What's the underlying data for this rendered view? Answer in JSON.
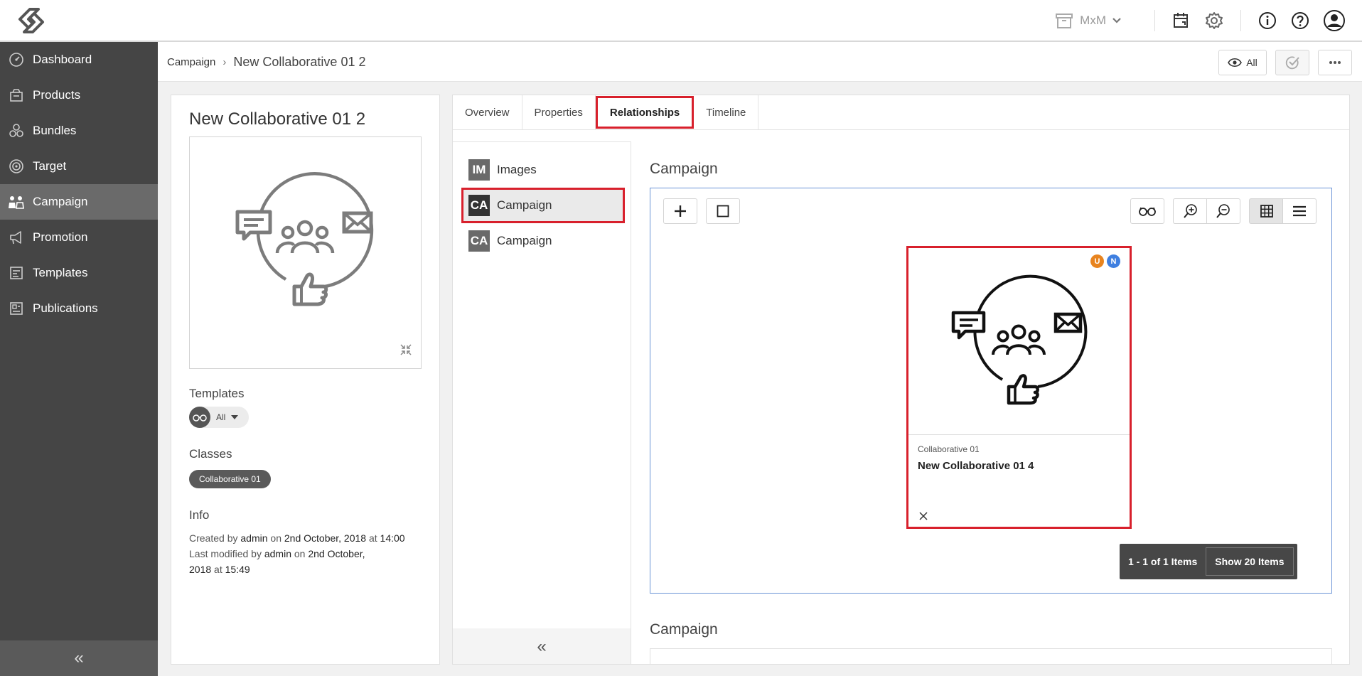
{
  "topbar": {
    "workspace_label": "MxM"
  },
  "sidebar": {
    "items": [
      {
        "label": "Dashboard",
        "icon": "gauge-icon"
      },
      {
        "label": "Products",
        "icon": "box-icon"
      },
      {
        "label": "Bundles",
        "icon": "bundles-icon"
      },
      {
        "label": "Target",
        "icon": "target-icon"
      },
      {
        "label": "Campaign",
        "icon": "campaign-icon",
        "active": true
      },
      {
        "label": "Promotion",
        "icon": "megaphone-icon"
      },
      {
        "label": "Templates",
        "icon": "template-icon"
      },
      {
        "label": "Publications",
        "icon": "publication-icon"
      }
    ],
    "collapse_glyph": "«"
  },
  "header": {
    "breadcrumb_root": "Campaign",
    "breadcrumb_sep": "›",
    "breadcrumb_current": "New Collaborative 01 2",
    "view_filter_label": "All"
  },
  "detail": {
    "title": "New Collaborative 01 2",
    "templates_label": "Templates",
    "templates_value": "All",
    "classes_label": "Classes",
    "class_chip": "Collaborative 01",
    "info_label": "Info",
    "created_prefix": "Created by",
    "created_user": "admin",
    "created_on": "on",
    "created_date": "2nd October, 2018",
    "created_at": "at",
    "created_time": "14:00",
    "modified_prefix": "Last modified by",
    "modified_user": "admin",
    "modified_on": "on",
    "modified_date_line1": "2nd October,",
    "modified_date_line2": "2018",
    "modified_at": "at",
    "modified_time": "15:49"
  },
  "tabs": [
    {
      "label": "Overview"
    },
    {
      "label": "Properties"
    },
    {
      "label": "Relationships",
      "active": true
    },
    {
      "label": "Timeline"
    }
  ],
  "relationship_list": [
    {
      "badge": "IM",
      "label": "Images"
    },
    {
      "badge": "CA",
      "label": "Campaign",
      "active": true
    },
    {
      "badge": "CA",
      "label": "Campaign"
    }
  ],
  "relationship_section": {
    "title": "Campaign",
    "second_title": "Campaign",
    "card": {
      "class": "Collaborative 01",
      "name": "New Collaborative 01 4",
      "status_badges": [
        {
          "letter": "U",
          "color": "#e8841f"
        },
        {
          "letter": "N",
          "color": "#3f7fe0"
        }
      ]
    },
    "pager_count": "1 - 1 of 1 Items",
    "pager_show": "Show 20 Items"
  },
  "colors": {
    "sidebar_bg": "#454545",
    "highlight": "#d8202c",
    "focus_border": "#6b94d6"
  }
}
